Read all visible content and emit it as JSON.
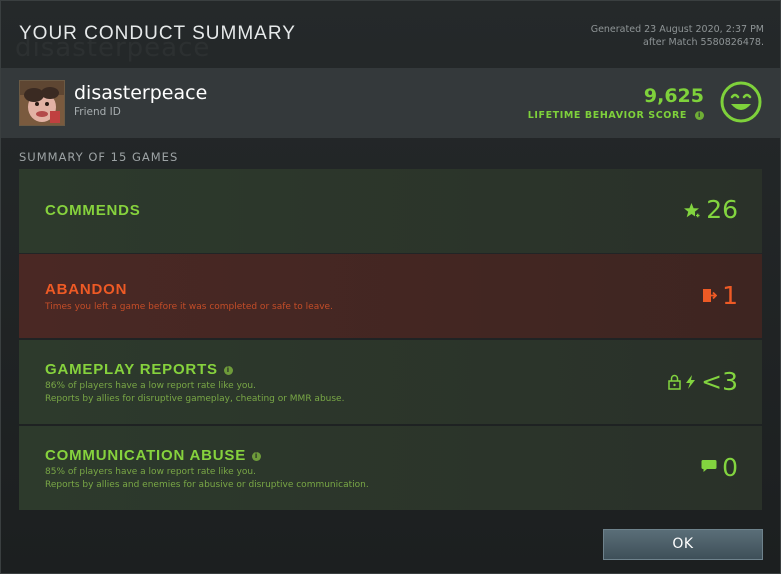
{
  "header": {
    "title": "YOUR CONDUCT SUMMARY",
    "generated_line1": "Generated 23 August 2020, 2:37 PM",
    "generated_line2": "after Match 5580826478."
  },
  "profile": {
    "username": "disasterpeace",
    "friend_id_label": "Friend ID",
    "score": "9,625",
    "score_label": "LIFETIME BEHAVIOR SCORE"
  },
  "summary": {
    "title": "SUMMARY OF 15 GAMES",
    "cards": [
      {
        "title": "COMMENDS",
        "value": "26"
      },
      {
        "title": "ABANDON",
        "sub1": "Times you left a game before it was completed or safe to leave.",
        "value": "1"
      },
      {
        "title": "GAMEPLAY REPORTS",
        "sub1": "86% of players have a low report rate like you.",
        "sub2": "Reports by allies for disruptive gameplay, cheating or MMR abuse.",
        "value": "<3"
      },
      {
        "title": "COMMUNICATION ABUSE",
        "sub1": "85% of players have a low report rate like you.",
        "sub2": "Reports by allies and enemies for abusive or disruptive communication.",
        "value": "0"
      }
    ]
  },
  "footer": {
    "ok_label": "OK"
  },
  "colors": {
    "positive": "#82d43f",
    "negative": "#ee5a25"
  },
  "icons": {
    "score": "smiley-icon",
    "commends": "star-icon",
    "abandon": "exit-door-icon",
    "gameplay": "lock-lightning-icon",
    "communication": "chat-bubble-icon"
  }
}
